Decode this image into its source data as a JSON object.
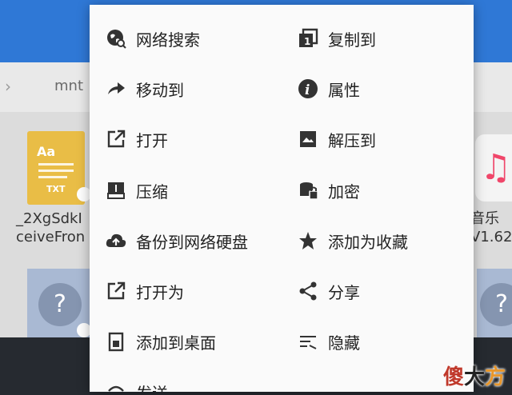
{
  "path_bar": {
    "segment": "mnt"
  },
  "files": [
    {
      "ext_label": "TXT",
      "icon_text": "Aa",
      "name_line1": "_2XgSdkI",
      "name_line2": "ceiveFron"
    },
    {
      "name_line1": "音乐",
      "name_line2": "V1.62"
    }
  ],
  "unknown_glyph": "?",
  "menu": {
    "left": [
      {
        "label": "网络搜索",
        "icon": "globe-search-icon"
      },
      {
        "label": "移动到",
        "icon": "move-arrow-icon"
      },
      {
        "label": "打开",
        "icon": "open-external-icon"
      },
      {
        "label": "压缩",
        "icon": "compress-icon"
      },
      {
        "label": "备份到网络硬盘",
        "icon": "cloud-upload-icon"
      },
      {
        "label": "打开为",
        "icon": "open-as-icon"
      },
      {
        "label": "添加到桌面",
        "icon": "add-to-desktop-icon"
      },
      {
        "label": "发送",
        "icon": "send-icon"
      }
    ],
    "right": [
      {
        "label": "复制到",
        "icon": "copy-icon"
      },
      {
        "label": "属性",
        "icon": "info-icon"
      },
      {
        "label": "解压到",
        "icon": "extract-icon"
      },
      {
        "label": "加密",
        "icon": "encrypt-icon"
      },
      {
        "label": "添加为收藏",
        "icon": "star-icon"
      },
      {
        "label": "分享",
        "icon": "share-icon"
      },
      {
        "label": "隐藏",
        "icon": "hide-icon"
      }
    ]
  },
  "watermark": {
    "c1": "傻",
    "c2": "大",
    "c3": "方"
  },
  "colors": {
    "header": "#2f78d6",
    "menu_bg": "#fafafa",
    "icon": "#333333",
    "bottom_bar": "#262a30"
  }
}
